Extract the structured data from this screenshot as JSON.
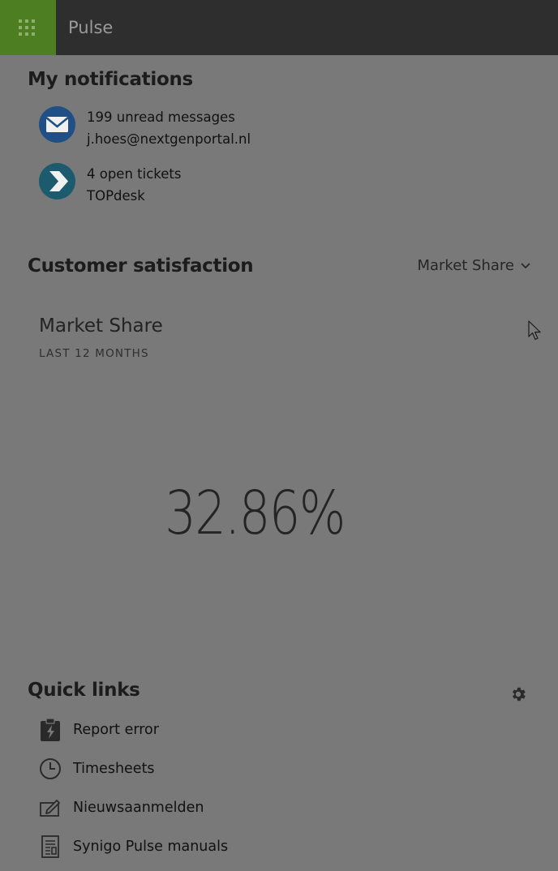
{
  "header": {
    "waffle_icon": "app-launcher-icon",
    "app_title": "Pulse",
    "brand_color": "#4d7f22",
    "bar_color": "#2e2e2e"
  },
  "notifications": {
    "title": "My notifications",
    "items": [
      {
        "icon": "mail-icon",
        "line1": "199 unread messages",
        "line2": "j.hoes@nextgenportal.nl"
      },
      {
        "icon": "topdesk-icon",
        "line1": "4 open tickets",
        "line2": "TOPdesk"
      }
    ]
  },
  "satisfaction": {
    "title": "Customer satisfaction",
    "dropdown": {
      "selected": "Market Share",
      "icon": "chevron-down-icon"
    },
    "card": {
      "title": "Market Share",
      "subtitle": "LAST 12 MONTHS",
      "value": "32.86%"
    }
  },
  "quick_links": {
    "title": "Quick links",
    "settings_icon": "gear-icon",
    "items": [
      {
        "icon": "clipboard-bolt-icon",
        "label": "Report error"
      },
      {
        "icon": "clock-icon",
        "label": "Timesheets"
      },
      {
        "icon": "pencil-icon",
        "label": "Nieuwsaanmelden"
      },
      {
        "icon": "document-icon",
        "label": "Synigo Pulse manuals"
      }
    ]
  }
}
